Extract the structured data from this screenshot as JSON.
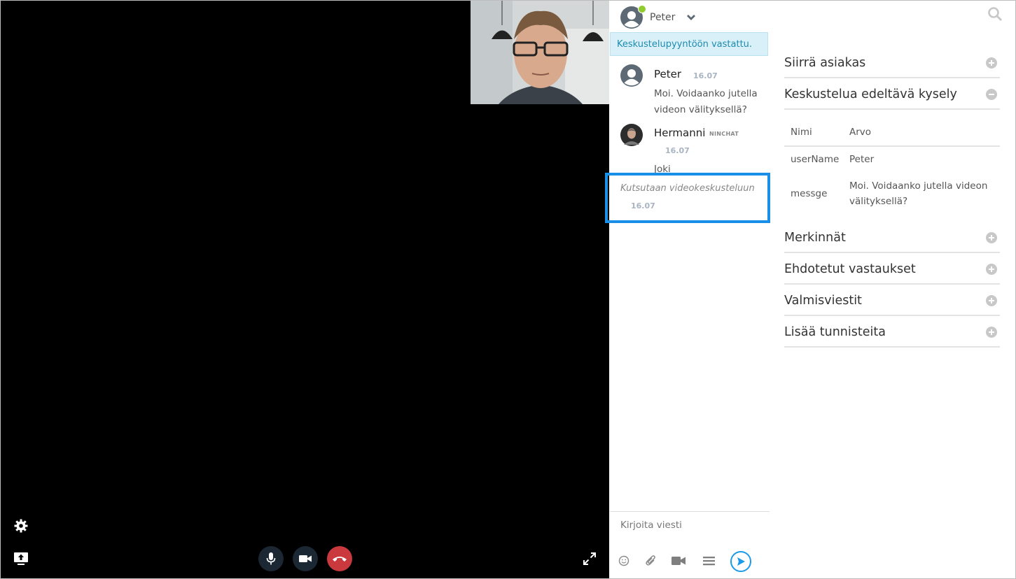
{
  "header": {
    "user_name": "Peter"
  },
  "banner": "Keskustelupyyntöön vastattu.",
  "messages": [
    {
      "sender": "Peter",
      "time": "16.07",
      "text_line1": "Moi. Voidaanko jutella",
      "text_line2": "videon välityksellä?"
    },
    {
      "sender": "Hermanni",
      "tag": "NINCHAT",
      "time": "16.07",
      "text": "Joki"
    }
  ],
  "invite": {
    "text": "Kutsutaan videokeskusteluun",
    "time": "16.07"
  },
  "composer": {
    "placeholder": "Kirjoita viesti"
  },
  "panel": {
    "sections": [
      {
        "title": "Siirrä asiakas",
        "state": "collapsed"
      },
      {
        "title": "Keskustelua edeltävä kysely",
        "state": "expanded"
      },
      {
        "title": "Merkinnät",
        "state": "collapsed"
      },
      {
        "title": "Ehdotetut vastaukset",
        "state": "collapsed"
      },
      {
        "title": "Valmisviestit",
        "state": "collapsed"
      },
      {
        "title": "Lisää tunnisteita",
        "state": "collapsed"
      }
    ],
    "form": {
      "header_key": "Nimi",
      "header_value": "Arvo",
      "rows": [
        {
          "key": "userName",
          "value": "Peter"
        },
        {
          "key": "messge",
          "value_line1": "Moi. Voidaanko jutella videon",
          "value_line2": "välityksellä?"
        }
      ]
    }
  },
  "colors": {
    "accent": "#1a8fe8",
    "hangup": "#c9393d",
    "online": "#8fcc2e",
    "banner_bg": "#d9f0f8"
  },
  "icons": [
    "settings-icon",
    "screen-share-icon",
    "microphone-icon",
    "camera-icon",
    "hangup-icon",
    "fullscreen-icon",
    "search-icon",
    "emoji-icon",
    "attachment-icon",
    "video-icon",
    "menu-icon",
    "send-icon"
  ]
}
